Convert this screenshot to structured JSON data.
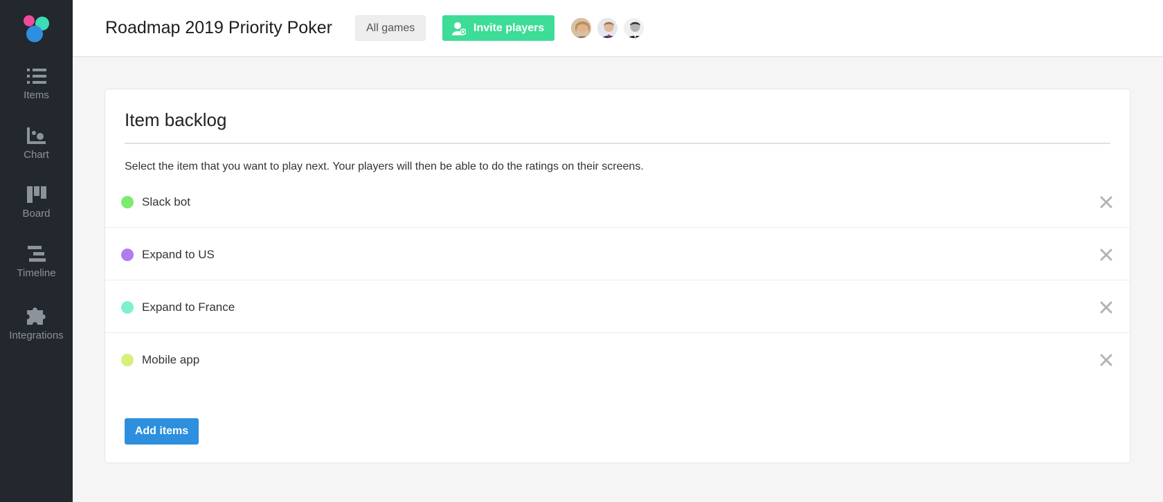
{
  "sidebar": {
    "logo_colors": [
      "#ee4c9b",
      "#3ddcb4",
      "#2d8fdd"
    ],
    "items": [
      {
        "label": "Items",
        "icon": "list-icon"
      },
      {
        "label": "Chart",
        "icon": "chart-icon"
      },
      {
        "label": "Board",
        "icon": "board-icon"
      },
      {
        "label": "Timeline",
        "icon": "timeline-icon"
      },
      {
        "label": "Integrations",
        "icon": "puzzle-icon"
      }
    ]
  },
  "header": {
    "title": "Roadmap 2019 Priority Poker",
    "all_games_label": "All games",
    "invite_label": "Invite players",
    "invite_icon": "add-user-icon",
    "avatars": [
      "avatar-player-1",
      "avatar-player-2",
      "avatar-player-3"
    ]
  },
  "backlog": {
    "title": "Item backlog",
    "description": "Select the item that you want to play next. Your players will then be able to do the ratings on their screens.",
    "items": [
      {
        "label": "Slack bot",
        "color": "#7ceb6d"
      },
      {
        "label": "Expand to US",
        "color": "#b07cf0"
      },
      {
        "label": "Expand to France",
        "color": "#7ff0cf"
      },
      {
        "label": "Mobile app",
        "color": "#d7ef7b"
      }
    ],
    "add_label": "Add items"
  },
  "colors": {
    "sidebar_bg": "#23272e",
    "accent_green": "#3ddc97",
    "accent_blue": "#2d8fdd"
  }
}
